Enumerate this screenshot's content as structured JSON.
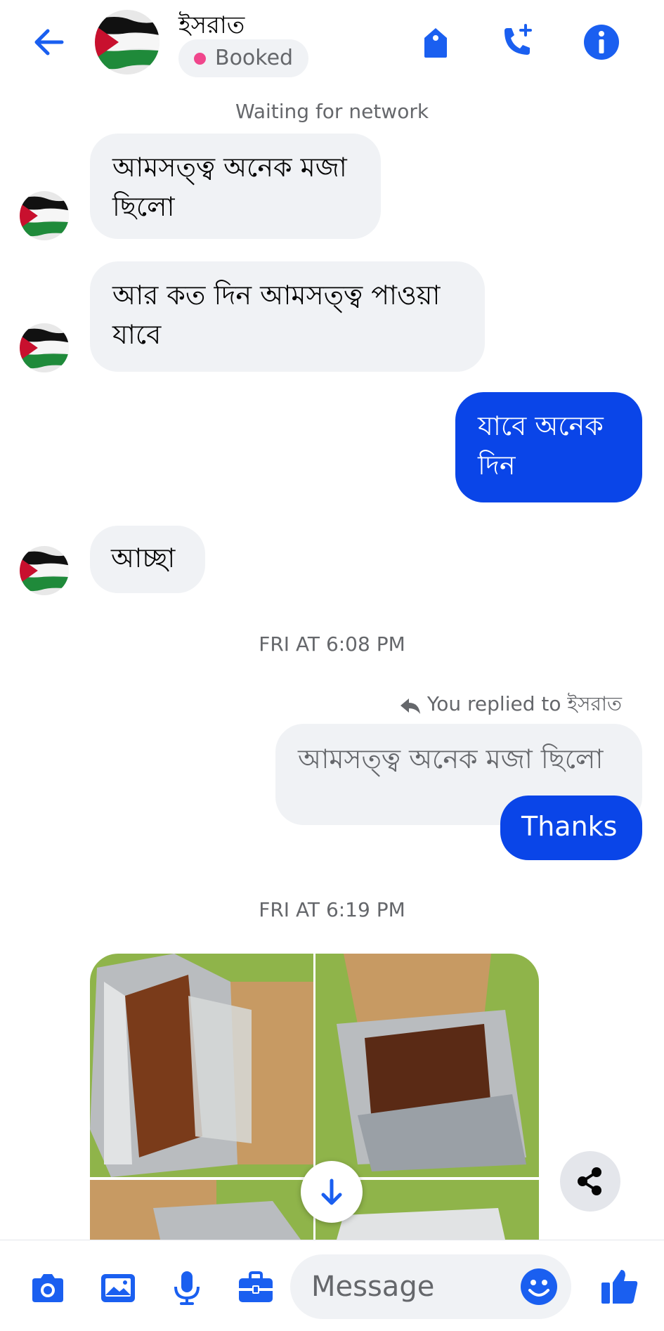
{
  "header": {
    "contact_name": "ইসরাত",
    "status": "Booked",
    "icons": [
      "back-arrow-icon",
      "tag-icon",
      "call-add-icon",
      "info-icon"
    ]
  },
  "system": {
    "network": "Waiting for network",
    "time1": "FRI AT 6:08 PM",
    "time2": "FRI AT 6:19 PM",
    "reply_note": "You replied to ইসরাত"
  },
  "messages": {
    "m1_l1": "আমসত্ত্ব অনেক মজা",
    "m1_l2": "ছিলো",
    "m2_l1": "আর কত দিন আমসত্ত্ব পাওয়া",
    "m2_l2": "যাবে",
    "m3_l1": "যাবে অনেক",
    "m3_l2": "দিন",
    "m4": "আচ্ছা",
    "quoted": "আমসত্ত্ব অনেক মজা ছিলো",
    "thanks": "Thanks"
  },
  "composer": {
    "placeholder": "Message"
  },
  "colors": {
    "accent": "#0a45e8",
    "icon_blue": "#1a5ff0",
    "bubble_in": "#f0f2f5",
    "status_dot": "#f0468c"
  }
}
